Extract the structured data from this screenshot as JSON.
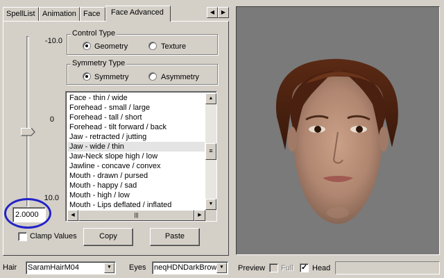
{
  "tabs": [
    "SpellList",
    "Animation",
    "Face",
    "Face Advanced"
  ],
  "active_tab": "Face Advanced",
  "slider": {
    "labels": {
      "top": "-10.0",
      "middle": "0",
      "bottom": "10.0"
    },
    "value": "2.0000",
    "range": [
      -10,
      10
    ],
    "position_value": 2.0
  },
  "control_type": {
    "title": "Control Type",
    "options": [
      "Geometry",
      "Texture"
    ],
    "selected": "Geometry"
  },
  "symmetry_type": {
    "title": "Symmetry Type",
    "options": [
      "Symmetry",
      "Asymmetry"
    ],
    "selected": "Symmetry"
  },
  "morph_list": {
    "items": [
      "Face - thin / wide",
      "Forehead - small / large",
      "Forehead - tall / short",
      "Forehead - tilt forward / back",
      "Jaw - retracted / jutting",
      "Jaw - wide / thin",
      "Jaw-Neck slope high / low",
      "Jawline - concave / convex",
      "Mouth - drawn / pursed",
      "Mouth - happy / sad",
      "Mouth - high / low",
      "Mouth - Lips deflated / inflated"
    ],
    "selected": "Jaw - wide / thin"
  },
  "clamp_values": {
    "label": "Clamp Values",
    "checked": false
  },
  "buttons": {
    "copy": "Copy",
    "paste": "Paste"
  },
  "bottom_bar": {
    "hair_label": "Hair",
    "hair_value": "SaramHairM04",
    "eyes_label": "Eyes",
    "eyes_value": "neqHDNDarkBrow",
    "preview_label": "Preview",
    "full_label": "Full",
    "full_checked": false,
    "head_label": "Head",
    "head_checked": true
  },
  "colors": {
    "window_bg": "#d4d0c8",
    "viewport_bg": "#7a7a7a",
    "annotation_ring": "#2323c8",
    "selection": "#e4e4e4"
  }
}
